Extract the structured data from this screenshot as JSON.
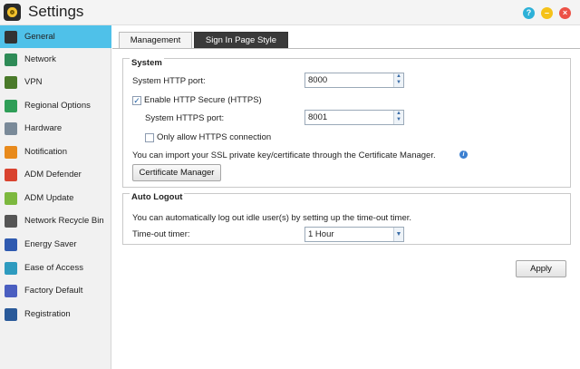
{
  "app": {
    "title": "Settings",
    "icon": "settings-app-icon"
  },
  "window_buttons": {
    "help": "?",
    "minimize": "–",
    "close": "×"
  },
  "sidebar": {
    "items": [
      {
        "label": "General",
        "icon": "general-icon",
        "color": "#333333",
        "active": true
      },
      {
        "label": "Network",
        "icon": "globe-icon",
        "color": "#2e8b57"
      },
      {
        "label": "VPN",
        "icon": "vpn-icon",
        "color": "#4a7a2a"
      },
      {
        "label": "Regional Options",
        "icon": "map-icon",
        "color": "#2f9e57"
      },
      {
        "label": "Hardware",
        "icon": "wrench-icon",
        "color": "#7a8a99"
      },
      {
        "label": "Notification",
        "icon": "alert-icon",
        "color": "#e88a1c"
      },
      {
        "label": "ADM Defender",
        "icon": "shield-icon",
        "color": "#d9432f"
      },
      {
        "label": "ADM Update",
        "icon": "update-arrow-icon",
        "color": "#7cb83e"
      },
      {
        "label": "Network Recycle Bin",
        "icon": "trash-icon",
        "color": "#555555"
      },
      {
        "label": "Energy Saver",
        "icon": "energy-icon",
        "color": "#2f5ab0"
      },
      {
        "label": "Ease of Access",
        "icon": "cloud-icon",
        "color": "#2e9bbf"
      },
      {
        "label": "Factory Default",
        "icon": "undo-icon",
        "color": "#4a5ec0"
      },
      {
        "label": "Registration",
        "icon": "registration-icon",
        "color": "#2a5a9a"
      }
    ]
  },
  "tabs": [
    {
      "label": "Management",
      "active": true
    },
    {
      "label": "Sign In Page Style",
      "active": false
    }
  ],
  "system": {
    "legend": "System",
    "http_port_label": "System HTTP port:",
    "http_port_value": "8000",
    "enable_https_label": "Enable HTTP Secure (HTTPS)",
    "enable_https_checked": true,
    "https_port_label": "System HTTPS port:",
    "https_port_value": "8001",
    "only_https_label": "Only allow HTTPS connection",
    "only_https_checked": false,
    "ssl_info": "You can import your SSL private key/certificate through the Certificate Manager.",
    "cert_manager_button": "Certificate Manager"
  },
  "auto_logout": {
    "legend": "Auto Logout",
    "description": "You can automatically log out idle user(s) by setting up the time-out timer.",
    "timer_label": "Time-out timer:",
    "timer_value": "1 Hour"
  },
  "apply_button": "Apply",
  "glyphs": {
    "check": "✓",
    "up": "▲",
    "down": "▼",
    "info": "i"
  }
}
